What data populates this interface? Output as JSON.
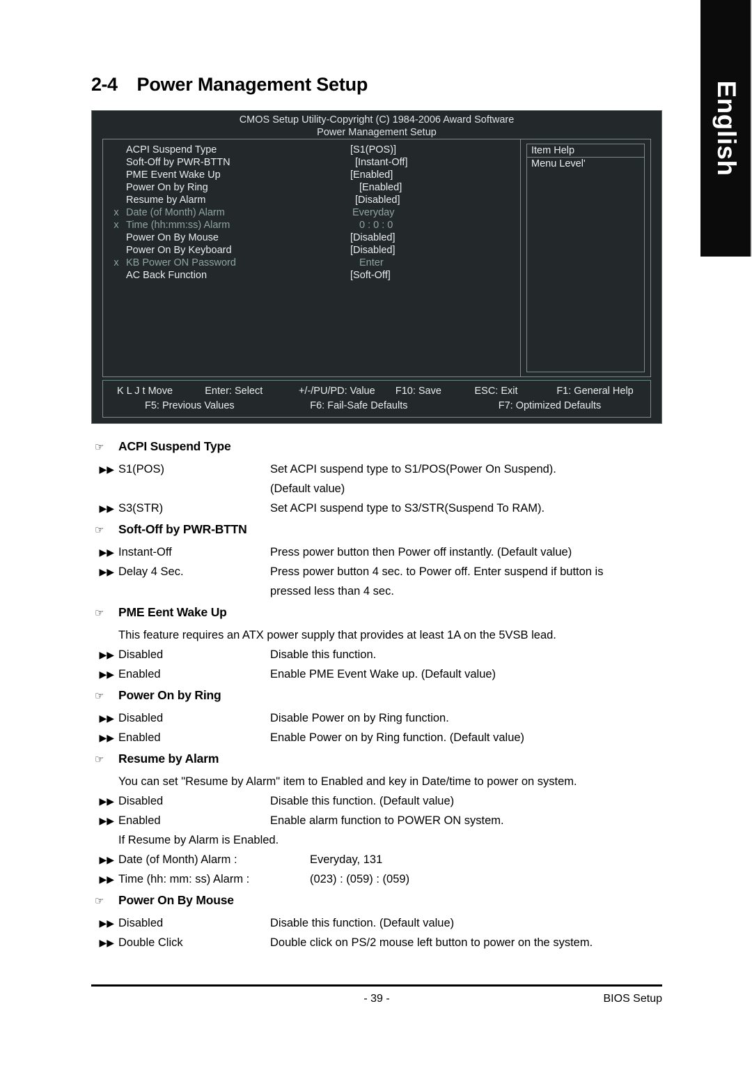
{
  "language_tab": {
    "label": "English"
  },
  "heading": {
    "number": "2-4",
    "title": "Power Management Setup"
  },
  "bios": {
    "title_line1": "CMOS Setup Utility-Copyright (C) 1984-2006 Award Software",
    "title_line2": "Power Management Setup",
    "settings": [
      {
        "x": "",
        "label": "ACPI Suspend Type",
        "value": "[S1(POS)]"
      },
      {
        "x": "",
        "label": "Soft-Off by PWR-BTTN",
        "value": "[Instant-Off]"
      },
      {
        "x": "",
        "label": "PME Event Wake Up",
        "value": "[Enabled]"
      },
      {
        "x": "",
        "label": "Power On by Ring",
        "value": "[Enabled]"
      },
      {
        "x": "",
        "label": "Resume by Alarm",
        "value": "[Disabled]"
      },
      {
        "x": "x",
        "label": "Date (of Month) Alarm",
        "value": "Everyday"
      },
      {
        "x": "x",
        "label": "Time (hh:mm:ss) Alarm",
        "value": "0 : 0 : 0"
      },
      {
        "x": "",
        "label": "Power On By Mouse",
        "value": "[Disabled]"
      },
      {
        "x": "",
        "label": "Power On By Keyboard",
        "value": "[Disabled]"
      },
      {
        "x": "x",
        "label": "KB Power ON Password",
        "value": "Enter"
      },
      {
        "x": "",
        "label": "AC Back Function",
        "value": "[Soft-Off]"
      }
    ],
    "help": {
      "title": "Item Help",
      "menu_level": "Menu Level'"
    },
    "keys": {
      "move": "K L J t Move",
      "enter": "Enter: Select",
      "value": "+/-/PU/PD: Value",
      "save": "F10: Save",
      "esc": "ESC: Exit",
      "f1": "F1: General Help",
      "f5": "F5: Previous Values",
      "f6": "F6: Fail-Safe Defaults",
      "f7": "F7: Optimized Defaults"
    }
  },
  "sections": {
    "acpi": {
      "header": "ACPI Suspend Type",
      "opt1_term": "S1(POS)",
      "opt1_desc": "Set ACPI suspend type to S1/POS(Power On Suspend).",
      "opt1_cont": "(Default value)",
      "opt2_term": "S3(STR)",
      "opt2_desc": "Set ACPI suspend type to S3/STR(Suspend To RAM)."
    },
    "softoff": {
      "header": "Soft-Off by PWR-BTTN",
      "opt1_term": "Instant-Off",
      "opt1_desc": "Press power button then Power off instantly. (Default value)",
      "opt2_term": "Delay 4 Sec.",
      "opt2_desc": "Press power button 4 sec. to Power off. Enter suspend if button is",
      "opt2_cont": "pressed less than 4 sec."
    },
    "pme": {
      "header": "PME Eent Wake Up",
      "note": "This feature requires an ATX power supply that provides at least 1A on the 5VSB lead.",
      "opt1_term": "Disabled",
      "opt1_desc": "Disable this function.",
      "opt2_term": "Enabled",
      "opt2_desc": "Enable PME Event Wake up. (Default value)"
    },
    "ring": {
      "header": "Power On by Ring",
      "opt1_term": "Disabled",
      "opt1_desc": "Disable Power on by Ring function.",
      "opt2_term": "Enabled",
      "opt2_desc": "Enable Power on by Ring function. (Default value)"
    },
    "alarm": {
      "header": "Resume by Alarm",
      "note": "You can set \"Resume by Alarm\" item to Enabled and key in Date/time to power on system.",
      "opt1_term": "Disabled",
      "opt1_desc": "Disable this function. (Default value)",
      "opt2_term": "Enabled",
      "opt2_desc": "Enable alarm function to POWER ON system.",
      "note2": "If Resume by Alarm is Enabled.",
      "opt3_term": "Date (of Month) Alarm :",
      "opt3_desc": "Everyday, 131",
      "opt4_term": "Time (hh: mm: ss) Alarm :",
      "opt4_desc": "(023) : (059) : (059)"
    },
    "mouse": {
      "header": "Power On By Mouse",
      "opt1_term": "Disabled",
      "opt1_desc": "Disable this function. (Default value)",
      "opt2_term": "Double Click",
      "opt2_desc": "Double click on PS/2 mouse left button to power on the system."
    }
  },
  "footer": {
    "page": "- 39 -",
    "tag": "BIOS Setup"
  },
  "glyphs": {
    "hand": "☞",
    "bullet": "▶▶"
  }
}
